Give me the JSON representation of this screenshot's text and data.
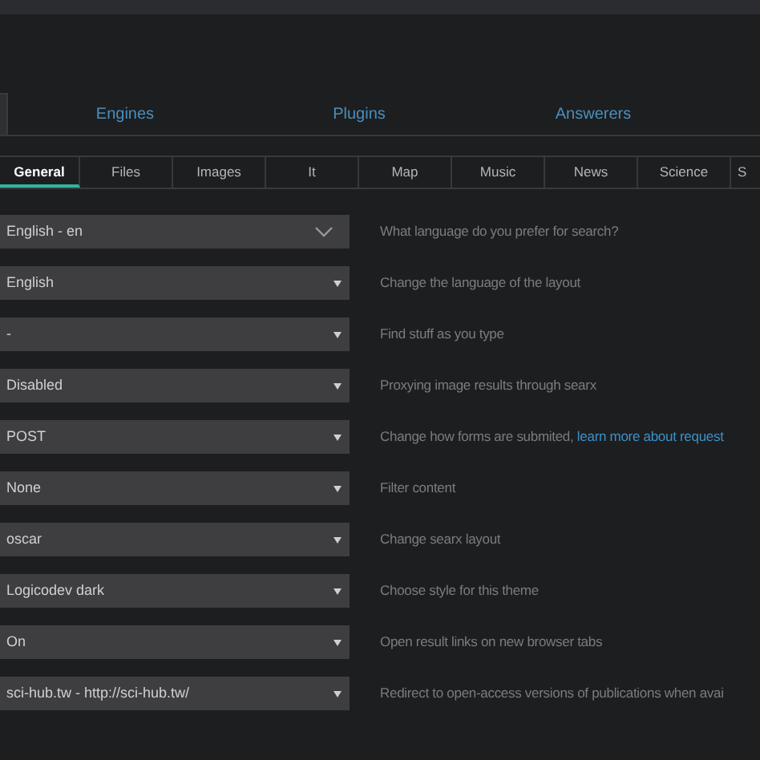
{
  "top_tabs": [
    {
      "selected": true
    },
    {
      "label": "Engines",
      "selected": false
    },
    {
      "label": "Plugins",
      "selected": false
    },
    {
      "label": "Answerers",
      "selected": false
    }
  ],
  "category_tabs": [
    {
      "label": "General",
      "selected": true
    },
    {
      "label": "Files",
      "selected": false
    },
    {
      "label": "Images",
      "selected": false
    },
    {
      "label": "It",
      "selected": false
    },
    {
      "label": "Map",
      "selected": false
    },
    {
      "label": "Music",
      "selected": false
    },
    {
      "label": "News",
      "selected": false
    },
    {
      "label": "Science",
      "selected": false
    },
    {
      "label": "S",
      "selected": false
    }
  ],
  "settings": [
    {
      "kind": "chevron",
      "value": "English - en",
      "description": "What language do you prefer for search?"
    },
    {
      "kind": "select",
      "value": "English",
      "description": "Change the language of the layout"
    },
    {
      "kind": "select",
      "value": "-",
      "description": "Find stuff as you type"
    },
    {
      "kind": "select",
      "value": "Disabled",
      "description": "Proxying image results through searx"
    },
    {
      "kind": "select",
      "value": "POST",
      "description": "Change how forms are submited,",
      "link": "learn more about request"
    },
    {
      "kind": "select",
      "value": "None",
      "description": "Filter content"
    },
    {
      "kind": "select",
      "value": "oscar",
      "description": "Change searx layout"
    },
    {
      "kind": "select",
      "value": "Logicodev dark",
      "description": "Choose style for this theme"
    },
    {
      "kind": "select",
      "value": "On",
      "description": "Open result links on new browser tabs"
    },
    {
      "kind": "select",
      "value": "sci-hub.tw - http://sci-hub.tw/",
      "description": "Redirect to open-access versions of publications when avai"
    }
  ]
}
